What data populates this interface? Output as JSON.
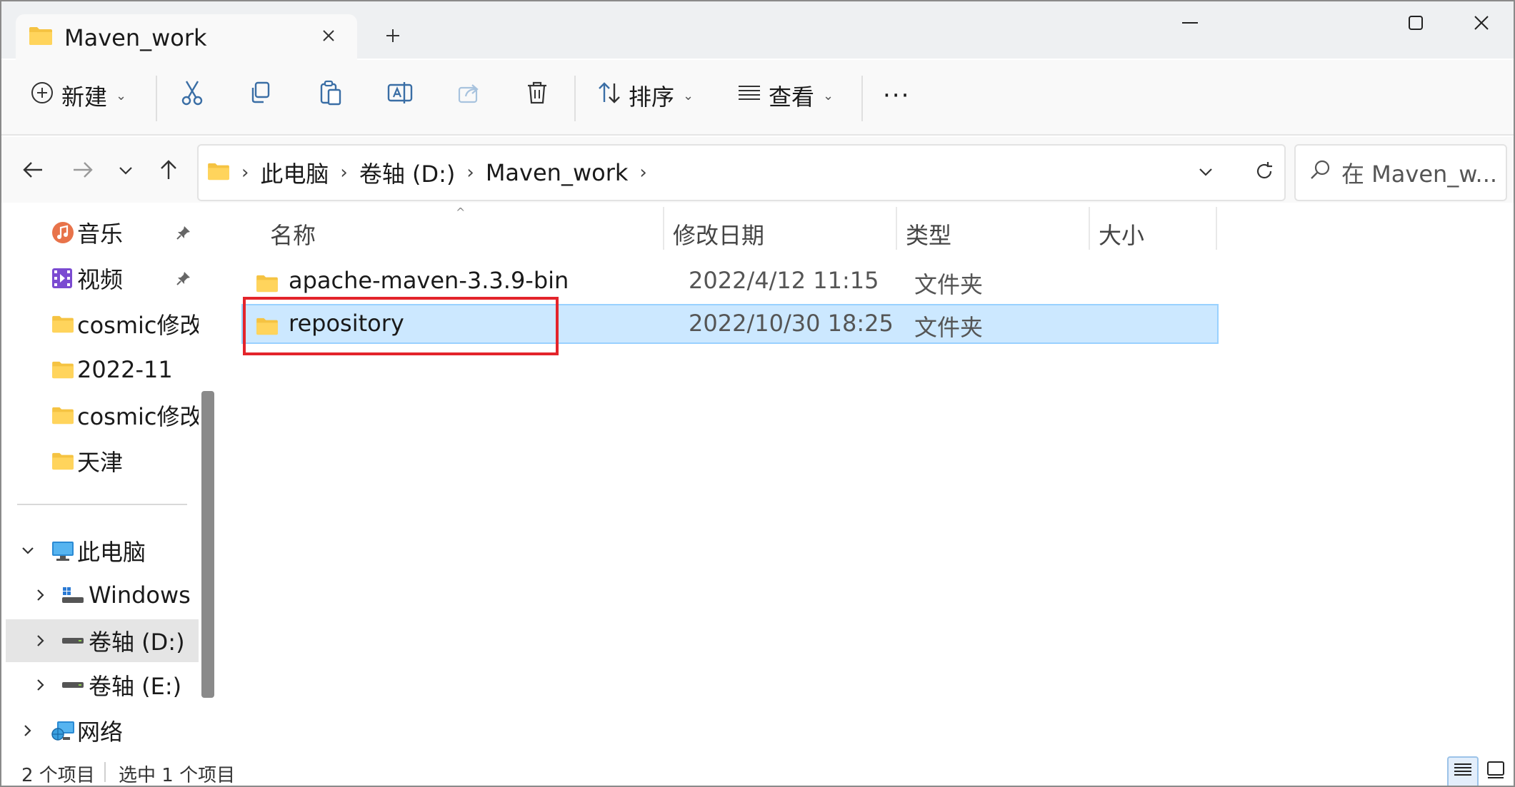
{
  "window": {
    "tab_title": "Maven_work",
    "new_tab_label": "+"
  },
  "toolbar": {
    "new_label": "新建",
    "sort_label": "排序",
    "view_label": "查看",
    "more_label": "···"
  },
  "address": {
    "crumbs": [
      "此电脑",
      "卷轴 (D:)",
      "Maven_work"
    ],
    "search_placeholder": "在 Maven_w..."
  },
  "nav": {
    "quick_access": [
      {
        "label": "音乐",
        "icon": "music-icon",
        "pinned": true
      },
      {
        "label": "视频",
        "icon": "video-icon",
        "pinned": true
      },
      {
        "label": "cosmic修改",
        "icon": "folder-icon",
        "pinned": false
      },
      {
        "label": "2022-11",
        "icon": "folder-icon",
        "pinned": false
      },
      {
        "label": "cosmic修改",
        "icon": "folder-icon",
        "pinned": false
      },
      {
        "label": "天津",
        "icon": "folder-icon",
        "pinned": false
      }
    ],
    "tree": [
      {
        "label": "此电脑",
        "icon": "computer-icon",
        "expanded": true,
        "level": 0
      },
      {
        "label": "Windows",
        "icon": "windows-drive-icon",
        "expanded": false,
        "level": 1
      },
      {
        "label": "卷轴 (D:)",
        "icon": "drive-icon",
        "expanded": false,
        "level": 1,
        "selected": true
      },
      {
        "label": "卷轴 (E:)",
        "icon": "drive-icon",
        "expanded": false,
        "level": 1
      },
      {
        "label": "网络",
        "icon": "network-icon",
        "expanded": false,
        "level": 0
      }
    ]
  },
  "columns": {
    "name": "名称",
    "modified": "修改日期",
    "type": "类型",
    "size": "大小"
  },
  "files": [
    {
      "name": "apache-maven-3.3.9-bin",
      "modified": "2022/4/12 11:15",
      "type": "文件夹",
      "selected": false
    },
    {
      "name": "repository",
      "modified": "2022/10/30 18:25",
      "type": "文件夹",
      "selected": true
    }
  ],
  "status": {
    "item_count": "2 个项目",
    "selected_count": "选中 1 个项目"
  },
  "colors": {
    "selection_bg": "#cce8ff",
    "highlight_box": "#e3242b",
    "folder_yellow": "#f5c342"
  }
}
